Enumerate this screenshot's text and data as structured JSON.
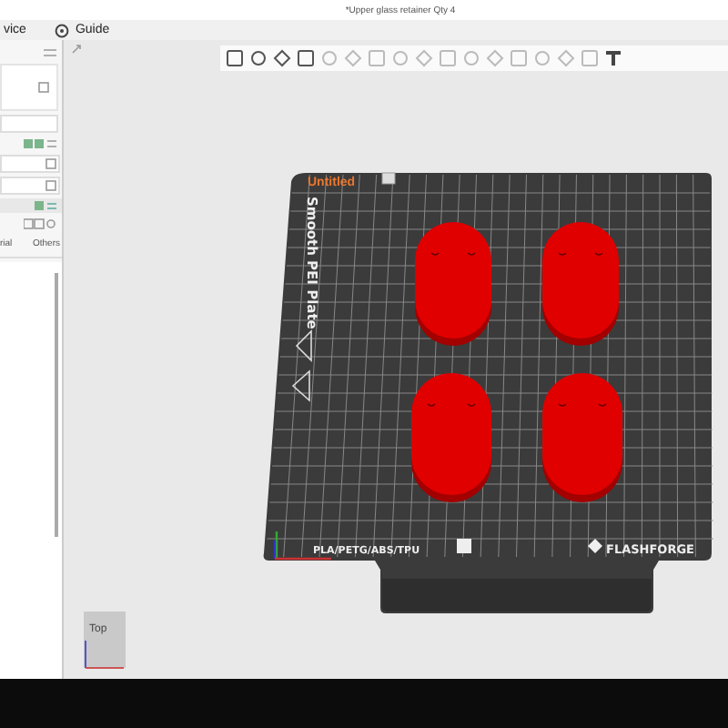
{
  "window": {
    "title": "*Upper glass retainer Qty 4"
  },
  "tabs": [
    {
      "label": "vice"
    },
    {
      "label": "Guide"
    }
  ],
  "sidebar": {
    "tabs": [
      "rial",
      "Others"
    ]
  },
  "viewport": {
    "plate_name": "Untitled",
    "plate_type": "Smooth PEI Plate",
    "materials": "PLA/PETG/ABS/TPU",
    "brand": "FLASHFORGE",
    "view_cube": "Top"
  }
}
